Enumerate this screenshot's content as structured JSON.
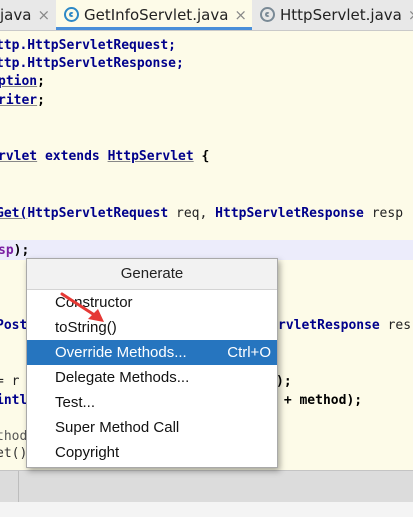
{
  "tabs": [
    {
      "label": "java",
      "active": false,
      "icon": "none"
    },
    {
      "label": "GetInfoServlet.java",
      "active": true,
      "icon": "java-class-icon"
    },
    {
      "label": "HttpServlet.java",
      "active": false,
      "icon": "java-class-icon"
    }
  ],
  "tab_close_glyph": "×",
  "code": {
    "l1": "ttp.HttpServletRequest;",
    "l2": "ttp.HttpServletResponse;",
    "l3a": "ption",
    "l3b": ";",
    "l4a": "riter",
    "l4b": ";",
    "l5a": "rvlet",
    "l5b": " extends ",
    "l5c": "HttpServlet",
    "l5d": " {",
    "l6a": "Get(",
    "l6b": "HttpServletRequest",
    "l6c": " req, ",
    "l6d": "HttpServletResponse",
    "l6e": " resp",
    "l7a": "sp",
    "l7b": ");",
    "l8a": "Post",
    "l8b": "rvletResponse",
    "l8c": " res",
    "l9a": "= r",
    "l9b": ");",
    "l10a": "intl",
    "l10b": " + method);",
    "l11": "thod",
    "l12": "et()"
  },
  "popup": {
    "title": "Generate",
    "items": [
      {
        "label": "Constructor",
        "shortcut": ""
      },
      {
        "label": "toString()",
        "shortcut": ""
      },
      {
        "label": "Override Methods...",
        "shortcut": "Ctrl+O",
        "selected": true
      },
      {
        "label": "Delegate Methods...",
        "shortcut": ""
      },
      {
        "label": "Test...",
        "shortcut": ""
      },
      {
        "label": "Super Method Call",
        "shortcut": ""
      },
      {
        "label": "Copyright",
        "shortcut": ""
      }
    ]
  },
  "colors": {
    "editor_background": "#fdfbe8",
    "selection": "#2675bf",
    "keyword": "#00008b",
    "annotation_arrow": "#e53935"
  }
}
